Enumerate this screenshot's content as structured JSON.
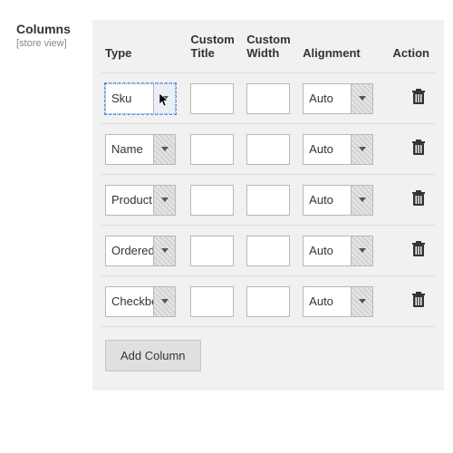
{
  "section": {
    "title": "Columns",
    "scope": "[store view]"
  },
  "headers": {
    "type": "Type",
    "custom_title": "Custom\nTitle",
    "custom_width": "Custom\nWidth",
    "alignment": "Alignment",
    "action": "Action"
  },
  "rows": [
    {
      "type": "Sku",
      "title": "",
      "width": "",
      "align": "Auto",
      "focused": true
    },
    {
      "type": "Name",
      "title": "",
      "width": "",
      "align": "Auto",
      "focused": false
    },
    {
      "type": "Product",
      "title": "",
      "width": "",
      "align": "Auto",
      "focused": false
    },
    {
      "type": "Ordered",
      "title": "",
      "width": "",
      "align": "Auto",
      "focused": false
    },
    {
      "type": "Checkbox",
      "title": "",
      "width": "",
      "align": "Auto",
      "focused": false
    }
  ],
  "buttons": {
    "add": "Add Column"
  },
  "icons": {
    "trash": "trash-icon",
    "dropdown": "chevron-down-icon"
  }
}
